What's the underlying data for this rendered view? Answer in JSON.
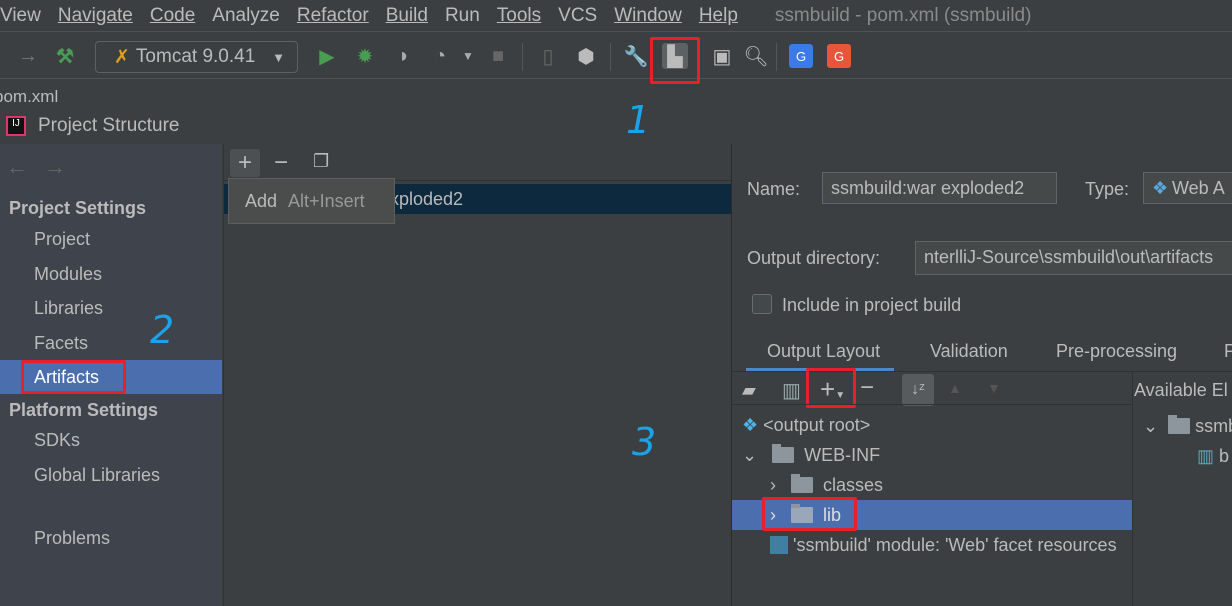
{
  "menubar": {
    "items": [
      "View",
      "Navigate",
      "Code",
      "Analyze",
      "Refactor",
      "Build",
      "Run",
      "Tools",
      "VCS",
      "Window",
      "Help"
    ],
    "window_title": "ssmbuild - pom.xml (ssmbuild)"
  },
  "toolbar": {
    "run_config": "Tomcat 9.0.41"
  },
  "file_tab": "pom.xml",
  "dialog": {
    "title": "Project Structure"
  },
  "sidebar": {
    "project_settings": "Project Settings",
    "items": [
      "Project",
      "Modules",
      "Libraries",
      "Facets",
      "Artifacts"
    ],
    "platform_settings": "Platform Settings",
    "platform_items": [
      "SDKs",
      "Global Libraries"
    ],
    "problems": "Problems",
    "selected": "Artifacts"
  },
  "artifacts": {
    "list_item": "ssmbuild:war exploded2",
    "list_item_visible": "xploded2",
    "tooltip": {
      "label": "Add",
      "shortcut": "Alt+Insert"
    }
  },
  "detail": {
    "name_label": "Name:",
    "name_value": "ssmbuild:war exploded2",
    "type_label": "Type:",
    "type_value": "Web A",
    "output_label": "Output directory:",
    "output_value": "nterlliJ-Source\\ssmbuild\\out\\artifacts",
    "include_label": "Include in project build",
    "include_checked": false,
    "tabs": [
      "Output Layout",
      "Validation",
      "Pre-processing",
      "P"
    ],
    "active_tab": "Output Layout",
    "tree": [
      "<output root>",
      "WEB-INF",
      "classes",
      "lib",
      "'ssmbuild' module: 'Web' facet resources"
    ],
    "selected_tree": "lib",
    "available_label": "Available El",
    "available_items": [
      "ssmb",
      "b"
    ]
  },
  "annotations": [
    "1",
    "2",
    "3"
  ],
  "colors": {
    "selection": "#4b6eaf",
    "highlight_box": "#e8202a",
    "annotation": "#1aa3e8",
    "run_green": "#499c54"
  }
}
